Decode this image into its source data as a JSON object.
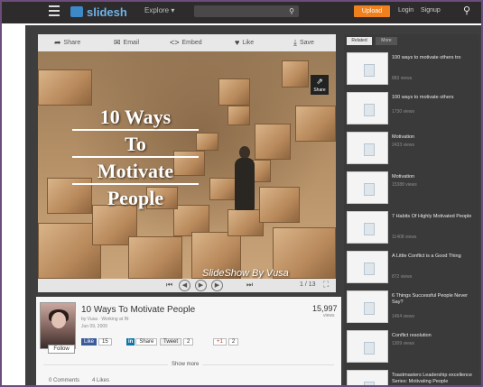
{
  "header": {
    "logo_text": "slidesh",
    "explore_label": "Explore ▾",
    "search_icon": "search-icon",
    "upload_label": "Upload",
    "login_label": "Login",
    "signup_label": "Signup"
  },
  "player": {
    "toolbar": {
      "share_label": "Share",
      "email_label": "Email",
      "embed_label": "Embed",
      "like_label": "Like",
      "save_label": "Save"
    },
    "slide": {
      "title_lines": [
        "10 Ways",
        "To",
        "Motivate",
        "People"
      ],
      "credit": "SlideShow By Vusa"
    },
    "share_overlay_label": "Share",
    "page_indicator": "1 / 13"
  },
  "deck": {
    "title": "10 Ways To Motivate People",
    "meta": "by Vusa · Working at IN",
    "date": "Jun 09, 2009",
    "views": "15,997",
    "views_label": "views",
    "follow_label": "Follow",
    "facebook": {
      "label": "Like",
      "count": "15"
    },
    "linkedin": {
      "label": "Share"
    },
    "twitter": {
      "label": "Tweet",
      "count": "2"
    },
    "googleplus": {
      "label": "+1",
      "count": "2"
    },
    "show_more": "Show more",
    "tabs": {
      "comments": "0 Comments",
      "likes": "4 Likes"
    }
  },
  "sidebar": {
    "tabs": {
      "active": "Related",
      "inactive": "More"
    },
    "items": [
      {
        "title": "100 ways to motivate others tro",
        "views": "883 views"
      },
      {
        "title": "100 ways to motivate others",
        "views": "1730 views"
      },
      {
        "title": "Motivation",
        "views": "2433 views"
      },
      {
        "title": "Motivation",
        "views": "15388 views"
      },
      {
        "title": "7 Habits Of Highly Motivated People",
        "views": "11408 views"
      },
      {
        "title": "A Little Conflict is a Good Thing",
        "views": "872 views"
      },
      {
        "title": "6 Things Successful People Never Say?",
        "views": "1464 views"
      },
      {
        "title": "Conflict resolution",
        "views": "1309 views"
      },
      {
        "title": "Toastmasters Leadership excellence Series: Motivating People",
        "views": "1871 views"
      }
    ]
  }
}
